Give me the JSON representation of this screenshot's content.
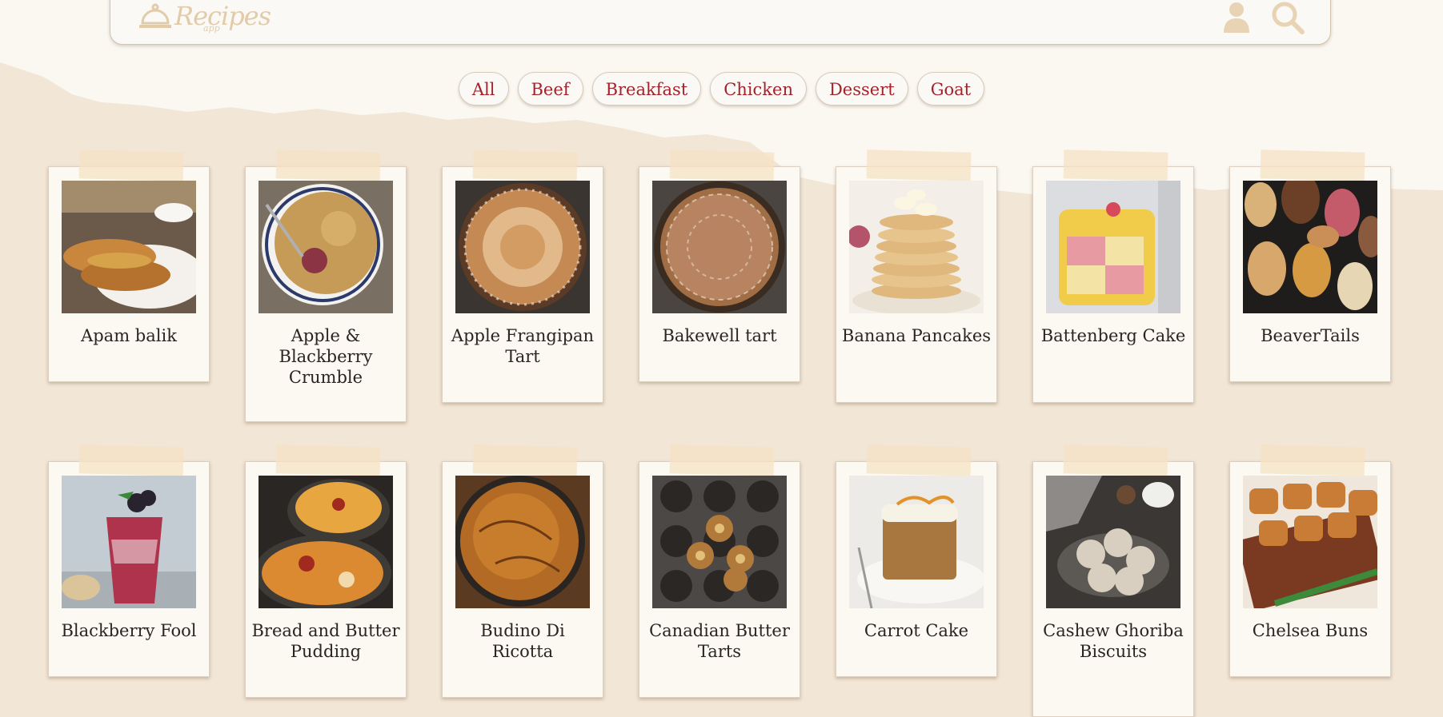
{
  "app": {
    "logo_text": "Recipes",
    "logo_sub": "app"
  },
  "header": {
    "user_icon": "user-icon",
    "search_icon": "search-icon",
    "logo_icon": "cloche-icon"
  },
  "filters": [
    "All",
    "Beef",
    "Breakfast",
    "Chicken",
    "Dessert",
    "Goat"
  ],
  "colors": {
    "accent": "#a3232c",
    "background": "#f2e6d6",
    "paper": "#fbf8f2",
    "logo": "#e2cba8"
  },
  "recipes": [
    {
      "name": "Apam balik"
    },
    {
      "name": "Apple & Blackberry Crumble"
    },
    {
      "name": "Apple Frangipan Tart"
    },
    {
      "name": "Bakewell tart"
    },
    {
      "name": "Banana Pancakes"
    },
    {
      "name": "Battenberg Cake"
    },
    {
      "name": "BeaverTails"
    },
    {
      "name": "Blackberry Fool"
    },
    {
      "name": "Bread and Butter Pudding"
    },
    {
      "name": "Budino Di Ricotta"
    },
    {
      "name": "Canadian Butter Tarts"
    },
    {
      "name": "Carrot Cake"
    },
    {
      "name": "Cashew Ghoriba Biscuits"
    },
    {
      "name": "Chelsea Buns"
    }
  ]
}
